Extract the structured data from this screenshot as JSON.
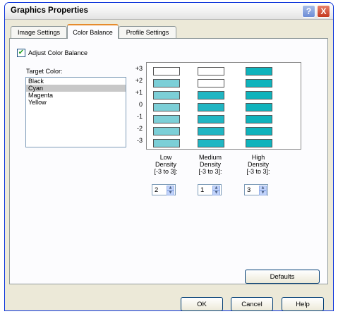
{
  "window": {
    "title": "Graphics Properties"
  },
  "title_buttons": {
    "help": "?",
    "close": "X"
  },
  "tabs": [
    {
      "label": "Image Settings",
      "active": false
    },
    {
      "label": "Color Balance",
      "active": true
    },
    {
      "label": "Profile Settings",
      "active": false
    }
  ],
  "adjust_checkbox": {
    "label": "Adjust Color Balance",
    "checked": true,
    "mark": "✔"
  },
  "target_color": {
    "label": "Target Color:",
    "options": [
      "Black",
      "Cyan",
      "Magenta",
      "Yellow"
    ],
    "selected": "Cyan"
  },
  "levels": [
    "+3",
    "+2",
    "+1",
    "0",
    "-1",
    "-2",
    "-3"
  ],
  "colors": {
    "empty": "#ffffff",
    "light_cyan": "#7ccfd7",
    "medium_cyan": "#20b6c3",
    "dark_cyan": "#0fb3bc"
  },
  "density_columns": [
    {
      "line1": "Low",
      "line2": "Density",
      "line3": "[-3 to 3]:",
      "value": "2"
    },
    {
      "line1": "Medium",
      "line2": "Density",
      "line3": "[-3 to 3]:",
      "value": "1"
    },
    {
      "line1": "High",
      "line2": "Density",
      "line3": "[-3 to 3]:",
      "value": "3"
    }
  ],
  "spinner_arrows": {
    "up": "▲",
    "down": "▼"
  },
  "buttons": {
    "defaults": "Defaults",
    "ok": "OK",
    "cancel": "Cancel",
    "help": "Help"
  }
}
